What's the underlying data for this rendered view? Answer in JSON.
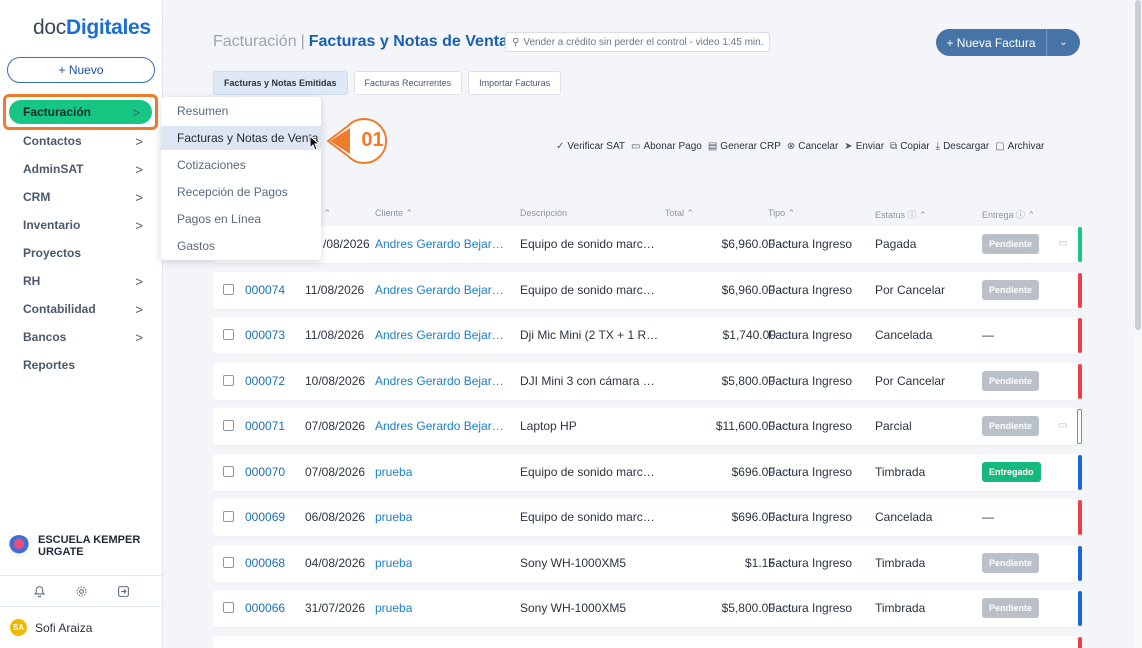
{
  "logo": {
    "part1": "doc",
    "part2": "Digitales"
  },
  "sidebar": {
    "new_label": "+ Nuevo",
    "active": {
      "label": "Facturación",
      "chevron": ">"
    },
    "items": [
      {
        "label": "Contactos",
        "chevron": ">"
      },
      {
        "label": "AdminSAT",
        "chevron": ">"
      },
      {
        "label": "CRM",
        "chevron": ">"
      },
      {
        "label": "Inventario",
        "chevron": ">"
      },
      {
        "label": "Proyectos",
        "chevron": ""
      },
      {
        "label": "RH",
        "chevron": ">"
      },
      {
        "label": "Contabilidad",
        "chevron": ">"
      },
      {
        "label": "Bancos",
        "chevron": ">"
      },
      {
        "label": "Reportes",
        "chevron": ""
      }
    ],
    "org": {
      "line1": "ESCUELA KEMPER",
      "line2": "URGATE"
    },
    "user": {
      "initials": "SA",
      "name": "Sofi Araiza"
    }
  },
  "header": {
    "section": "Facturación",
    "separator": "|",
    "page": "Facturas y Notas de Venta",
    "video_link": "Vender a crédito sin perder el control - video 1:45 min.",
    "primary_button": "+ Nueva Factura",
    "dropdown_chevron": "⌄"
  },
  "tabs": [
    "Facturas y Notas Emitidas",
    "Facturas Recurrentes",
    "Importar Facturas"
  ],
  "actions": [
    {
      "icon": "✓",
      "label": "Verificar SAT"
    },
    {
      "icon": "▭",
      "label": "Abonar Pago"
    },
    {
      "icon": "▤",
      "label": "Generar CRP"
    },
    {
      "icon": "⊗",
      "label": "Cancelar"
    },
    {
      "icon": "➤",
      "label": "Enviar"
    },
    {
      "icon": "⧉",
      "label": "Copiar"
    },
    {
      "icon": "⤓",
      "label": "Descargar"
    },
    {
      "icon": "▢",
      "label": "Archivar"
    }
  ],
  "table": {
    "headers": {
      "fecha": "ha ⌃",
      "cliente": "Cliente ⌃",
      "descripcion": "Descripción",
      "total": "Total ⌃",
      "tipo": "Tipo ⌃",
      "estatus": "Estatus ⓘ ⌃",
      "entrega": "Entrega ⓘ ⌃"
    },
    "rows": [
      {
        "folio": "",
        "fecha": "/08/2026",
        "cliente": "Andres Gerardo Bejarano ...",
        "desc": "Equipo de sonido marca J...",
        "total": "$6,960.00",
        "cur": "MXN",
        "tipo": "Factura Ingreso",
        "estatus": "Pagada",
        "entrega": "Pendiente",
        "cash": "▭"
      },
      {
        "folio": "000074",
        "fecha": "11/08/2026",
        "cliente": "Andres Gerardo Bejarano ...",
        "desc": "Equipo de sonido marca J...",
        "total": "$6,960.00",
        "cur": "MXN",
        "tipo": "Factura Ingreso",
        "estatus": "Por Cancelar",
        "entrega": "Pendiente",
        "cash": ""
      },
      {
        "folio": "000073",
        "fecha": "11/08/2026",
        "cliente": "Andres Gerardo Bejarano ...",
        "desc": "Dji Mic Mini (2 TX + 1 RX ...",
        "total": "$1,740.00",
        "cur": "EUR",
        "tipo": "Factura Ingreso",
        "estatus": "Cancelada",
        "entrega": "—",
        "cash": ""
      },
      {
        "folio": "000072",
        "fecha": "10/08/2026",
        "cliente": "Andres Gerardo Bejarano ...",
        "desc": "DJI Mini 3 con cámara Lig...",
        "total": "$5,800.00",
        "cur": "MXN",
        "tipo": "Factura Ingreso",
        "estatus": "Por Cancelar",
        "entrega": "Pendiente",
        "cash": ""
      },
      {
        "folio": "000071",
        "fecha": "07/08/2026",
        "cliente": "Andres Gerardo Bejarano ...",
        "desc": "Laptop HP",
        "total": "$11,600.00",
        "cur": "MXN",
        "tipo": "Factura Ingreso",
        "estatus": "Parcial",
        "entrega": "Pendiente",
        "cash": "▭"
      },
      {
        "folio": "000070",
        "fecha": "07/08/2026",
        "cliente": "prueba",
        "desc": "Equipo de sonido marca J...",
        "total": "$696.00",
        "cur": "MXN",
        "tipo": "Factura Ingreso",
        "estatus": "Timbrada",
        "entrega": "Entregado",
        "cash": ""
      },
      {
        "folio": "000069",
        "fecha": "06/08/2026",
        "cliente": "prueba",
        "desc": "Equipo de sonido marca J...",
        "total": "$696.00",
        "cur": "MXN",
        "tipo": "Factura Ingreso",
        "estatus": "Cancelada",
        "entrega": "—",
        "cash": ""
      },
      {
        "folio": "000068",
        "fecha": "04/08/2026",
        "cliente": "prueba",
        "desc": "Sony WH-1000XM5",
        "total": "$1.16",
        "cur": "MXN",
        "tipo": "Factura Ingreso",
        "estatus": "Timbrada",
        "entrega": "Pendiente",
        "cash": ""
      },
      {
        "folio": "000066",
        "fecha": "31/07/2026",
        "cliente": "prueba",
        "desc": "Sony WH-1000XM5",
        "total": "$5,800.00",
        "cur": "MXN",
        "tipo": "Factura Ingreso",
        "estatus": "Timbrada",
        "entrega": "Pendiente",
        "cash": ""
      }
    ]
  },
  "menu": {
    "items": [
      "Resumen",
      "Facturas y Notas de Venta",
      "Cotizaciones",
      "Recepción de Pagos",
      "Pagos en Línea",
      "Gastos"
    ],
    "highlighted": "Facturas y Notas de Venta"
  },
  "callout": {
    "number": "01"
  },
  "colors": {
    "accent_green": "#16c784",
    "brand_blue": "#1a5fb4",
    "highlight_orange": "#ee7c2d",
    "status_red": "#ef3e4a",
    "status_blue": "#1768d6"
  }
}
